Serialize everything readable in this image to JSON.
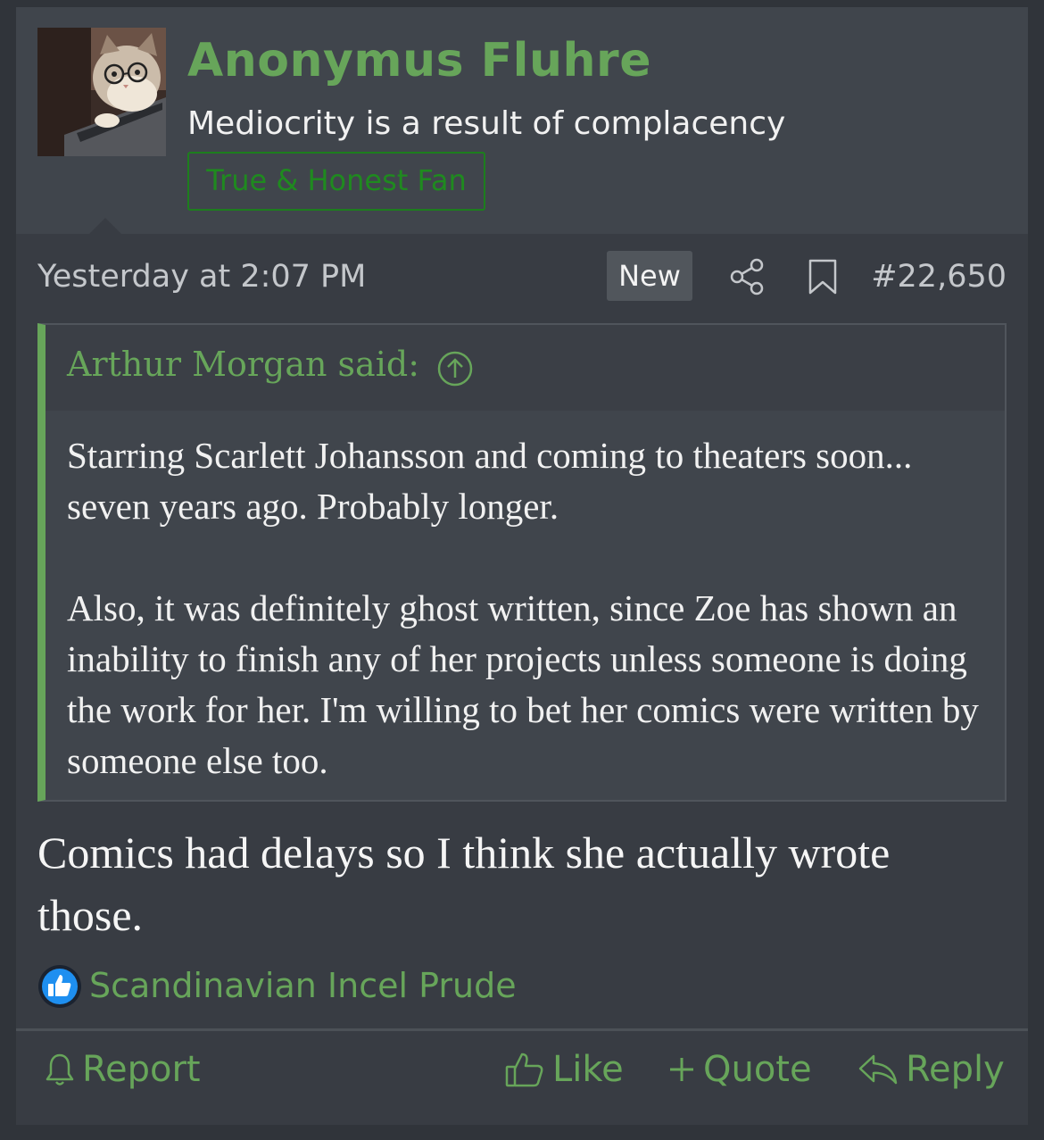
{
  "user": {
    "name": "Anonymus Fluhre",
    "title": "Mediocrity is a result of complacency",
    "banner": "True & Honest Fan"
  },
  "post": {
    "date": "Yesterday at 2:07 PM",
    "new_badge": "New",
    "number": "#22,650",
    "message": "Comics had delays so I think she actually wrote those."
  },
  "quote": {
    "author": "Arthur Morgan said:",
    "paragraphs": [
      "Starring Scarlett Johansson and coming to theaters soon... seven years ago. Probably longer.",
      "Also, it was definitely ghost written, since Zoe has shown an inability to finish any of her projects unless someone is doing the work for her. I'm willing to bet her comics were written by someone else too."
    ]
  },
  "reactions": {
    "icon": "thumbs-up",
    "users": "Scandinavian Incel Prude"
  },
  "actions": {
    "report": "Report",
    "like": "Like",
    "quote": "Quote",
    "reply": "Reply"
  },
  "colors": {
    "accent": "#67a55a",
    "banner": "#1f8a1f",
    "background": "#383c43",
    "header": "#40454c"
  }
}
